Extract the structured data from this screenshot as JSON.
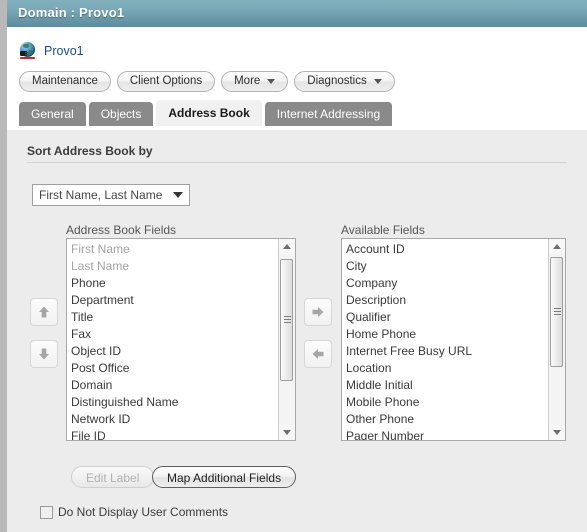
{
  "window": {
    "title": "Domain : Provo1"
  },
  "object": {
    "icon": "globe-network-icon",
    "name": "Provo1"
  },
  "toolbar": {
    "buttons": [
      {
        "label": "Maintenance",
        "has_caret": false
      },
      {
        "label": "Client Options",
        "has_caret": false
      },
      {
        "label": "More",
        "has_caret": true
      },
      {
        "label": "Diagnostics",
        "has_caret": true
      }
    ]
  },
  "tabs": [
    {
      "label": "General",
      "active": false
    },
    {
      "label": "Objects",
      "active": false
    },
    {
      "label": "Address Book",
      "active": true
    },
    {
      "label": "Internet Addressing",
      "active": false
    }
  ],
  "main": {
    "section_title": "Sort Address Book by",
    "sort_select": {
      "value": "First Name, Last Name"
    },
    "left_list": {
      "label": "Address Book Fields",
      "items": [
        {
          "text": "First Name",
          "disabled": true
        },
        {
          "text": "Last Name",
          "disabled": true
        },
        {
          "text": "Phone",
          "disabled": false
        },
        {
          "text": "Department",
          "disabled": false
        },
        {
          "text": "Title",
          "disabled": false
        },
        {
          "text": "Fax",
          "disabled": false
        },
        {
          "text": "Object ID",
          "disabled": false
        },
        {
          "text": "Post Office",
          "disabled": false
        },
        {
          "text": "Domain",
          "disabled": false
        },
        {
          "text": "Distinguished Name",
          "disabled": false
        },
        {
          "text": "Network ID",
          "disabled": false
        },
        {
          "text": "File ID",
          "disabled": false
        }
      ]
    },
    "right_list": {
      "label": "Available Fields",
      "items": [
        {
          "text": "Account ID",
          "disabled": false
        },
        {
          "text": "City",
          "disabled": false
        },
        {
          "text": "Company",
          "disabled": false
        },
        {
          "text": "Description",
          "disabled": false
        },
        {
          "text": "Qualifier",
          "disabled": false
        },
        {
          "text": "Home Phone",
          "disabled": false
        },
        {
          "text": "Internet Free Busy URL",
          "disabled": false
        },
        {
          "text": "Location",
          "disabled": false
        },
        {
          "text": "Middle Initial",
          "disabled": false
        },
        {
          "text": "Mobile Phone",
          "disabled": false
        },
        {
          "text": "Other Phone",
          "disabled": false
        },
        {
          "text": "Pager Number",
          "disabled": false
        }
      ]
    },
    "move_buttons": {
      "up": "move-up-icon",
      "down": "move-down-icon",
      "add": "move-right-icon",
      "remove": "move-left-icon"
    },
    "actions": {
      "edit_label": "Edit Label",
      "map_additional_fields": "Map Additional Fields"
    },
    "checkbox": {
      "label": "Do Not Display User Comments",
      "checked": false
    }
  },
  "colors": {
    "titlebar_top": "#82b0bd",
    "titlebar_bottom": "#5c8b9c",
    "panel_bg": "#ececec",
    "tab_inactive": "#8a8a8a",
    "tab_active": "#f1f1f1",
    "link": "#1d4f8c"
  }
}
